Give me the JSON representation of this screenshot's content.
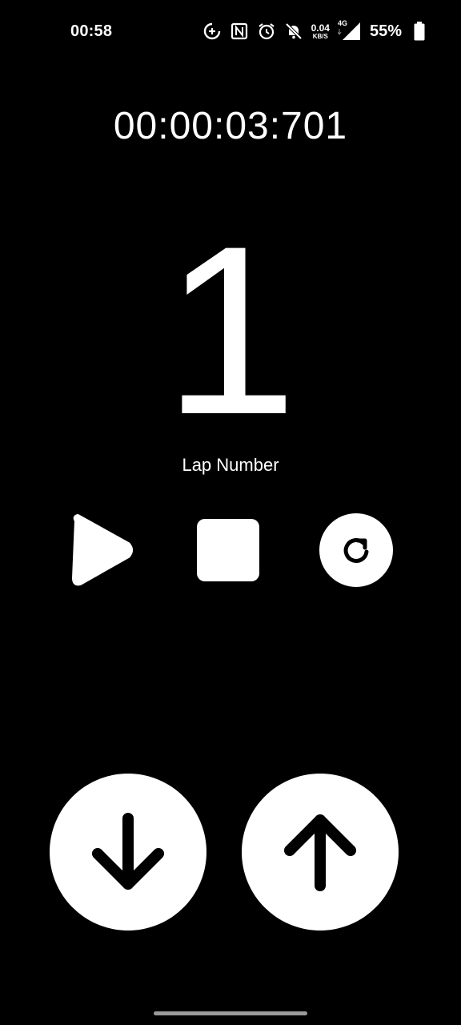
{
  "status_bar": {
    "time": "00:58",
    "net_speed_value": "0.04",
    "net_speed_unit": "KB/S",
    "network_type": "4G",
    "battery_percent": "55%",
    "icons": [
      "data-saver-icon",
      "nfc-icon",
      "alarm-icon",
      "mute-icon",
      "signal-icon",
      "battery-icon"
    ]
  },
  "timer": {
    "elapsed": "00:00:03:701"
  },
  "lap": {
    "number": "1",
    "label": "Lap Number"
  },
  "controls": {
    "icons": [
      "play-icon",
      "stop-icon",
      "reset-icon"
    ]
  },
  "counter_buttons": {
    "icons": [
      "arrow-down-icon",
      "arrow-up-icon"
    ]
  },
  "colors": {
    "background": "#000000",
    "foreground": "#ffffff"
  }
}
